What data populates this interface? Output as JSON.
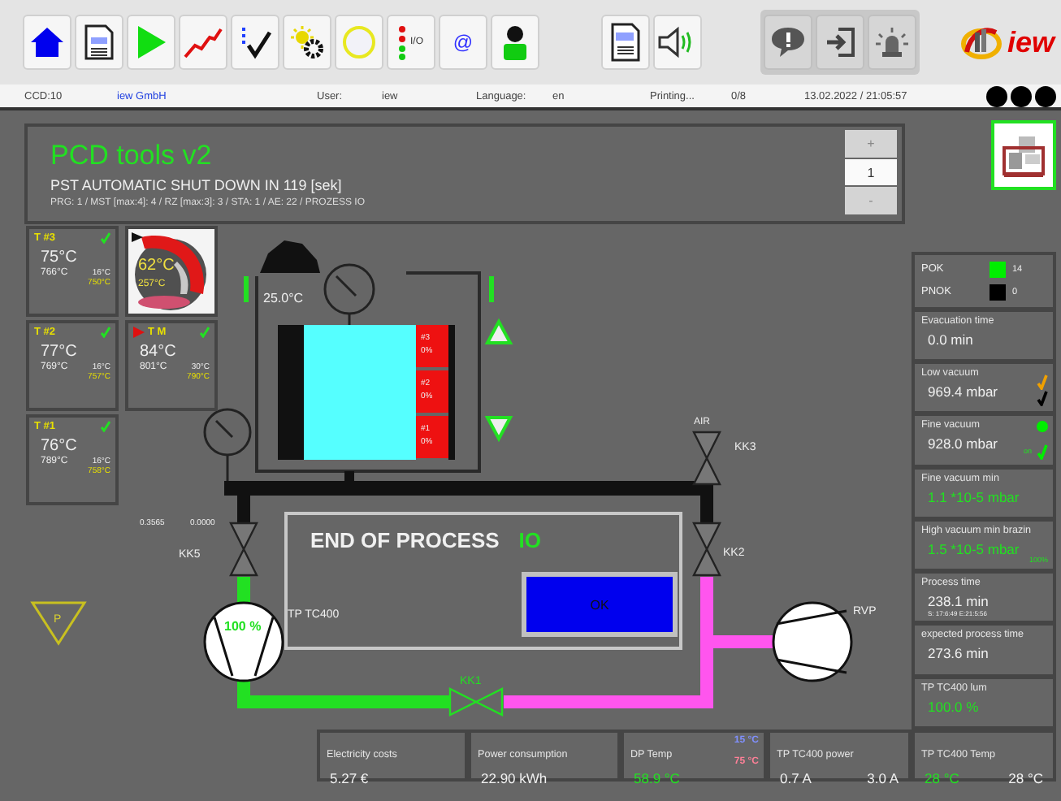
{
  "toolbar": {
    "groups": [
      {
        "kind": "plain",
        "buttons": [
          {
            "kind": "home"
          },
          {
            "kind": "program"
          },
          {
            "kind": "play"
          },
          {
            "kind": "chart"
          },
          {
            "kind": "checklist"
          },
          {
            "kind": "settings"
          },
          {
            "kind": "circle"
          },
          {
            "kind": "io",
            "label": "I/O"
          },
          {
            "kind": "email",
            "label": "@"
          },
          {
            "kind": "user"
          }
        ]
      },
      {
        "kind": "plain",
        "buttons": [
          {
            "kind": "pdf"
          },
          {
            "kind": "sound"
          }
        ]
      },
      {
        "kind": "shaded",
        "buttons": [
          {
            "kind": "message"
          },
          {
            "kind": "logout"
          },
          {
            "kind": "alarm"
          }
        ]
      }
    ],
    "logo": "iew"
  },
  "status_bar": {
    "station": "CCD:10",
    "company": "iew GmbH",
    "user_label": "User:",
    "user": "iew",
    "language_label": "Language:",
    "language": "en",
    "printing_label": "Printing...",
    "printing": "0/8",
    "datetime": "13.02.2022 / 21:05:57"
  },
  "header": {
    "title": "PCD tools v2",
    "message": "PST AUTOMATIC SHUT DOWN IN 119 [sek]",
    "info": "PRG: 1 / MST [max:4]: 4 / RZ [max:3]: 3 / STA: 1 / AE: 22 / PROZESS IO",
    "stepper": {
      "plus": "+",
      "value": "1",
      "minus": "-"
    }
  },
  "tiles": [
    {
      "kind": "sensor",
      "label": "T #3",
      "active": false,
      "checked": true,
      "temp": "75°C",
      "max": "766°C",
      "min": "16°C",
      "setpoint": "750°C"
    },
    {
      "kind": "picture",
      "temp": "62°C",
      "setpoint": "257°C"
    },
    {
      "kind": "sensor",
      "label": "T #2",
      "active": false,
      "checked": true,
      "temp": "77°C",
      "max": "769°C",
      "min": "16°C",
      "setpoint": "757°C"
    },
    {
      "kind": "sensor",
      "label": "T M",
      "active": true,
      "checked": true,
      "temp": "84°C",
      "max": "801°C",
      "min": "30°C",
      "setpoint": "790°C"
    },
    {
      "kind": "sensor",
      "label": "T #1",
      "active": false,
      "checked": true,
      "temp": "76°C",
      "max": "789°C",
      "min": "16°C",
      "setpoint": "758°C"
    }
  ],
  "diagram": {
    "chamber_temp": "25.0°C",
    "segments": [
      {
        "label": "#3",
        "value": "0%"
      },
      {
        "label": "#2",
        "value": "0%"
      },
      {
        "label": "#1",
        "value": "0%"
      }
    ],
    "readings": [
      "0.3565",
      "0.0000"
    ],
    "inlet": "AIR",
    "valves": [
      {
        "label": "KK5",
        "open": false
      },
      {
        "label": "KK3",
        "open": false
      },
      {
        "label": "KK2",
        "open": false
      },
      {
        "label": "KK1",
        "open": true
      }
    ],
    "pumps": [
      {
        "label": "TP TC400",
        "speed": "100 %"
      },
      {
        "label": "RVP"
      }
    ],
    "warning": "P",
    "process": {
      "title": "END OF PROCESS",
      "result": "IO",
      "button": "OK"
    }
  },
  "counters": [
    {
      "label": "POK",
      "value": "14",
      "color": "#00ee00"
    },
    {
      "label": "PNOK",
      "value": "0",
      "color": "#000000"
    }
  ],
  "metrics": [
    {
      "label": "Evacuation time",
      "value": "0.0 min",
      "highlight": false
    },
    {
      "label": "Low vacuum",
      "value": "969.4 mbar",
      "highlight": false,
      "top_mark": {
        "kind": "check",
        "color": "#f0a000"
      },
      "bottom_mark": {
        "kind": "check",
        "color": "#000000"
      }
    },
    {
      "label": "Fine vacuum",
      "value": "928.0 mbar",
      "highlight": false,
      "top_mark": {
        "kind": "dot",
        "color": "#00ee00"
      },
      "note": "on",
      "bottom_mark": {
        "kind": "check",
        "color": "#00ee00"
      }
    },
    {
      "label": "Fine vacuum min",
      "value": "1.1 *10-5 mbar",
      "highlight": true
    },
    {
      "label": "High vacuum min brazin",
      "value": "1.5 *10-5 mbar",
      "highlight": true,
      "note": "100%"
    },
    {
      "label": "Process time",
      "value": "238.1 min",
      "highlight": false,
      "detail": "S: 17:6:49 E:21:5:56"
    },
    {
      "label": "expected process time",
      "value": "273.6 min",
      "highlight": false
    },
    {
      "label": "TP TC400 lum",
      "value": "100.0 %",
      "highlight": true
    }
  ],
  "bottom_panels": [
    {
      "label": "Electricity costs",
      "values": [
        {
          "text": "5.27 €",
          "highlight": false
        }
      ]
    },
    {
      "label": "Power consumption",
      "values": [
        {
          "text": "22.90 kWh",
          "highlight": false
        }
      ]
    },
    {
      "label": "DP Temp",
      "values": [
        {
          "text": "58.9 °C",
          "highlight": true
        }
      ],
      "limits": [
        {
          "text": "15 °C",
          "color": "#8090ff"
        },
        {
          "text": "75 °C",
          "color": "#ff8098"
        }
      ]
    },
    {
      "label": "TP TC400 power",
      "values": [
        {
          "text": "0.7 A",
          "highlight": false
        },
        {
          "text": "3.0 A",
          "highlight": false
        }
      ]
    },
    {
      "label": "TP TC400 Temp",
      "values": [
        {
          "text": "28 °C",
          "highlight": true
        },
        {
          "text": "28 °C",
          "highlight": false
        }
      ]
    }
  ]
}
